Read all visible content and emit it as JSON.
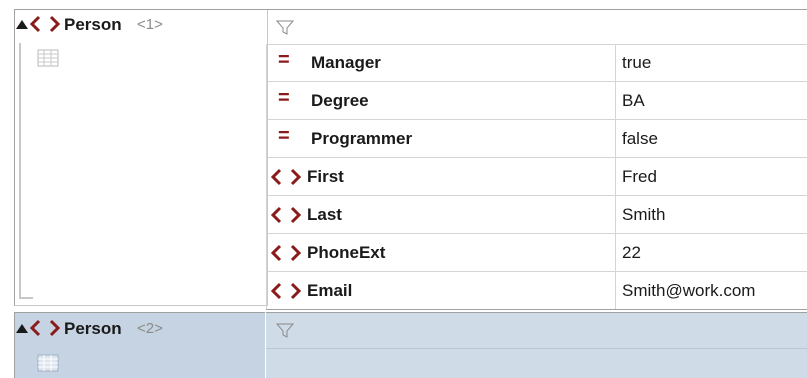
{
  "person_1": {
    "name": "Person",
    "index": "<1>",
    "attributes": [
      {
        "kind": "attribute",
        "icon": "equals-icon",
        "name": "Manager",
        "value": "true"
      },
      {
        "kind": "attribute",
        "icon": "equals-icon",
        "name": "Degree",
        "value": "BA"
      },
      {
        "kind": "attribute",
        "icon": "equals-icon",
        "name": "Programmer",
        "value": "false"
      },
      {
        "kind": "element",
        "icon": "element-icon",
        "name": "First",
        "value": "Fred"
      },
      {
        "kind": "element",
        "icon": "element-icon",
        "name": "Last",
        "value": "Smith"
      },
      {
        "kind": "element",
        "icon": "element-icon",
        "name": "PhoneExt",
        "value": "22"
      },
      {
        "kind": "element",
        "icon": "element-icon",
        "name": "Email",
        "value": "Smith@work.com"
      }
    ]
  },
  "person_2": {
    "name": "Person",
    "index": "<2>"
  },
  "colors": {
    "icon_red": "#8b1a1a",
    "selected_bg": "#c6d3e3",
    "grid_line": "#d4d4d4"
  }
}
